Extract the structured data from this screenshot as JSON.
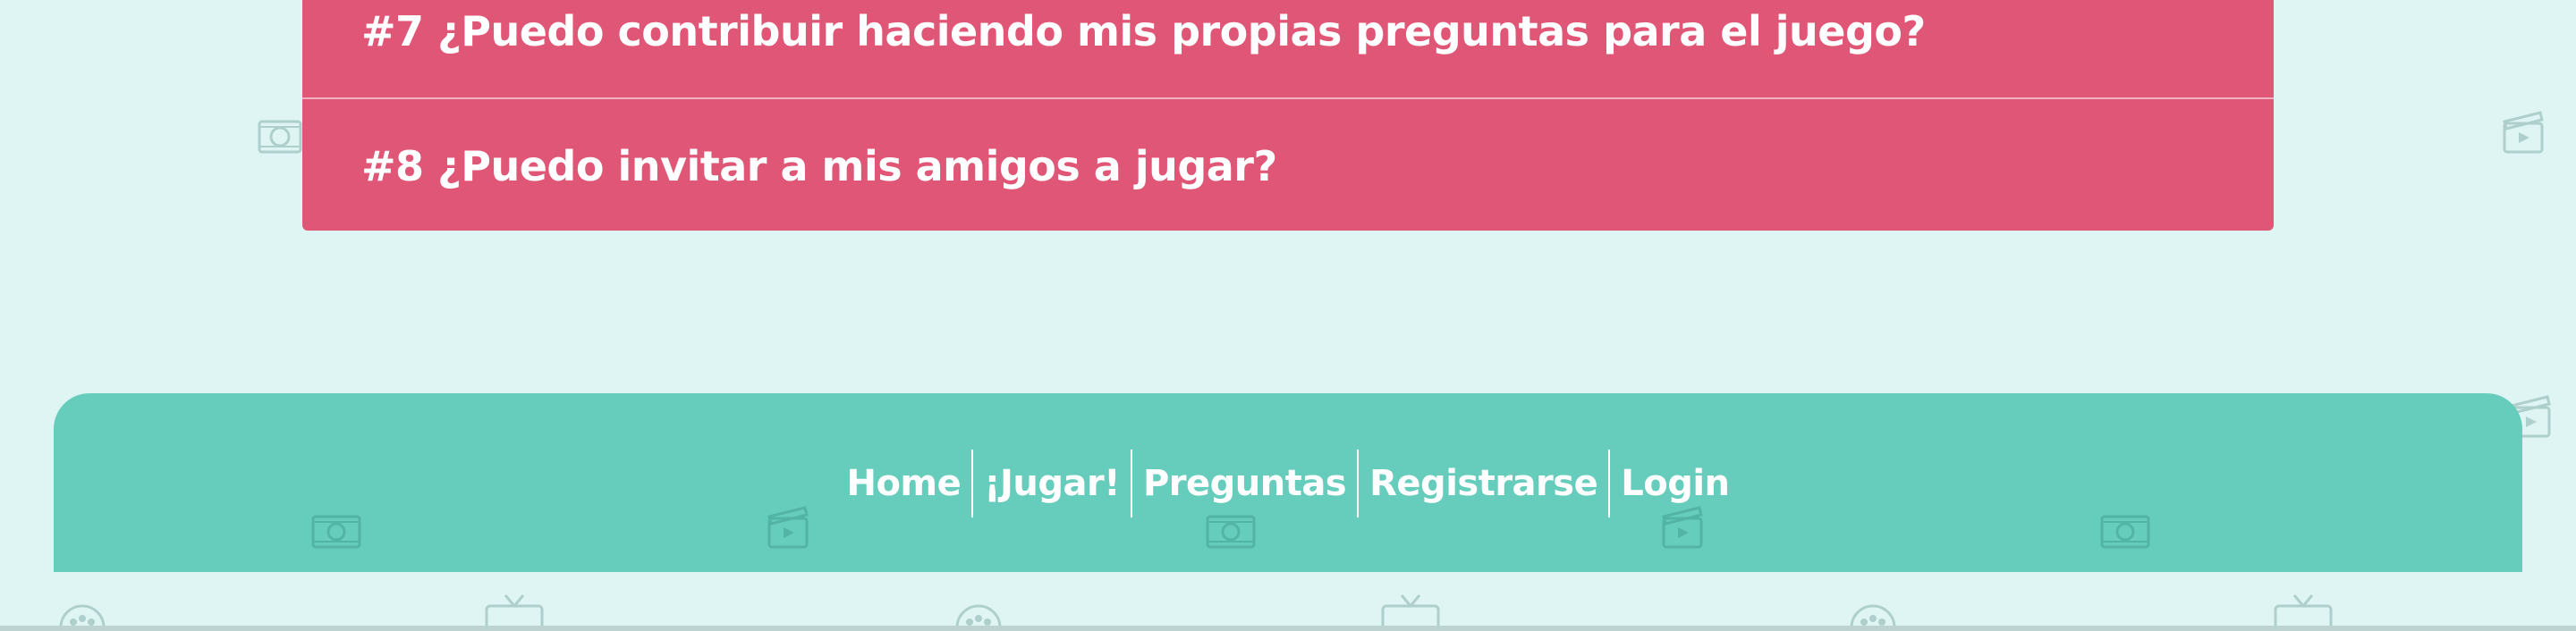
{
  "faq": {
    "items": [
      {
        "title": "#7 ¿Puedo contribuir haciendo mis propias preguntas para el juego?"
      },
      {
        "title": "#8 ¿Puedo invitar a mis amigos a jugar?"
      }
    ]
  },
  "footer": {
    "nav": [
      {
        "label": "Home"
      },
      {
        "label": "¡Jugar!"
      },
      {
        "label": "Preguntas"
      },
      {
        "label": "Registrarse"
      },
      {
        "label": "Login"
      }
    ]
  },
  "background": {
    "icons": [
      "film-reel-icon",
      "clapperboard-icon",
      "retro-tv-icon"
    ]
  }
}
